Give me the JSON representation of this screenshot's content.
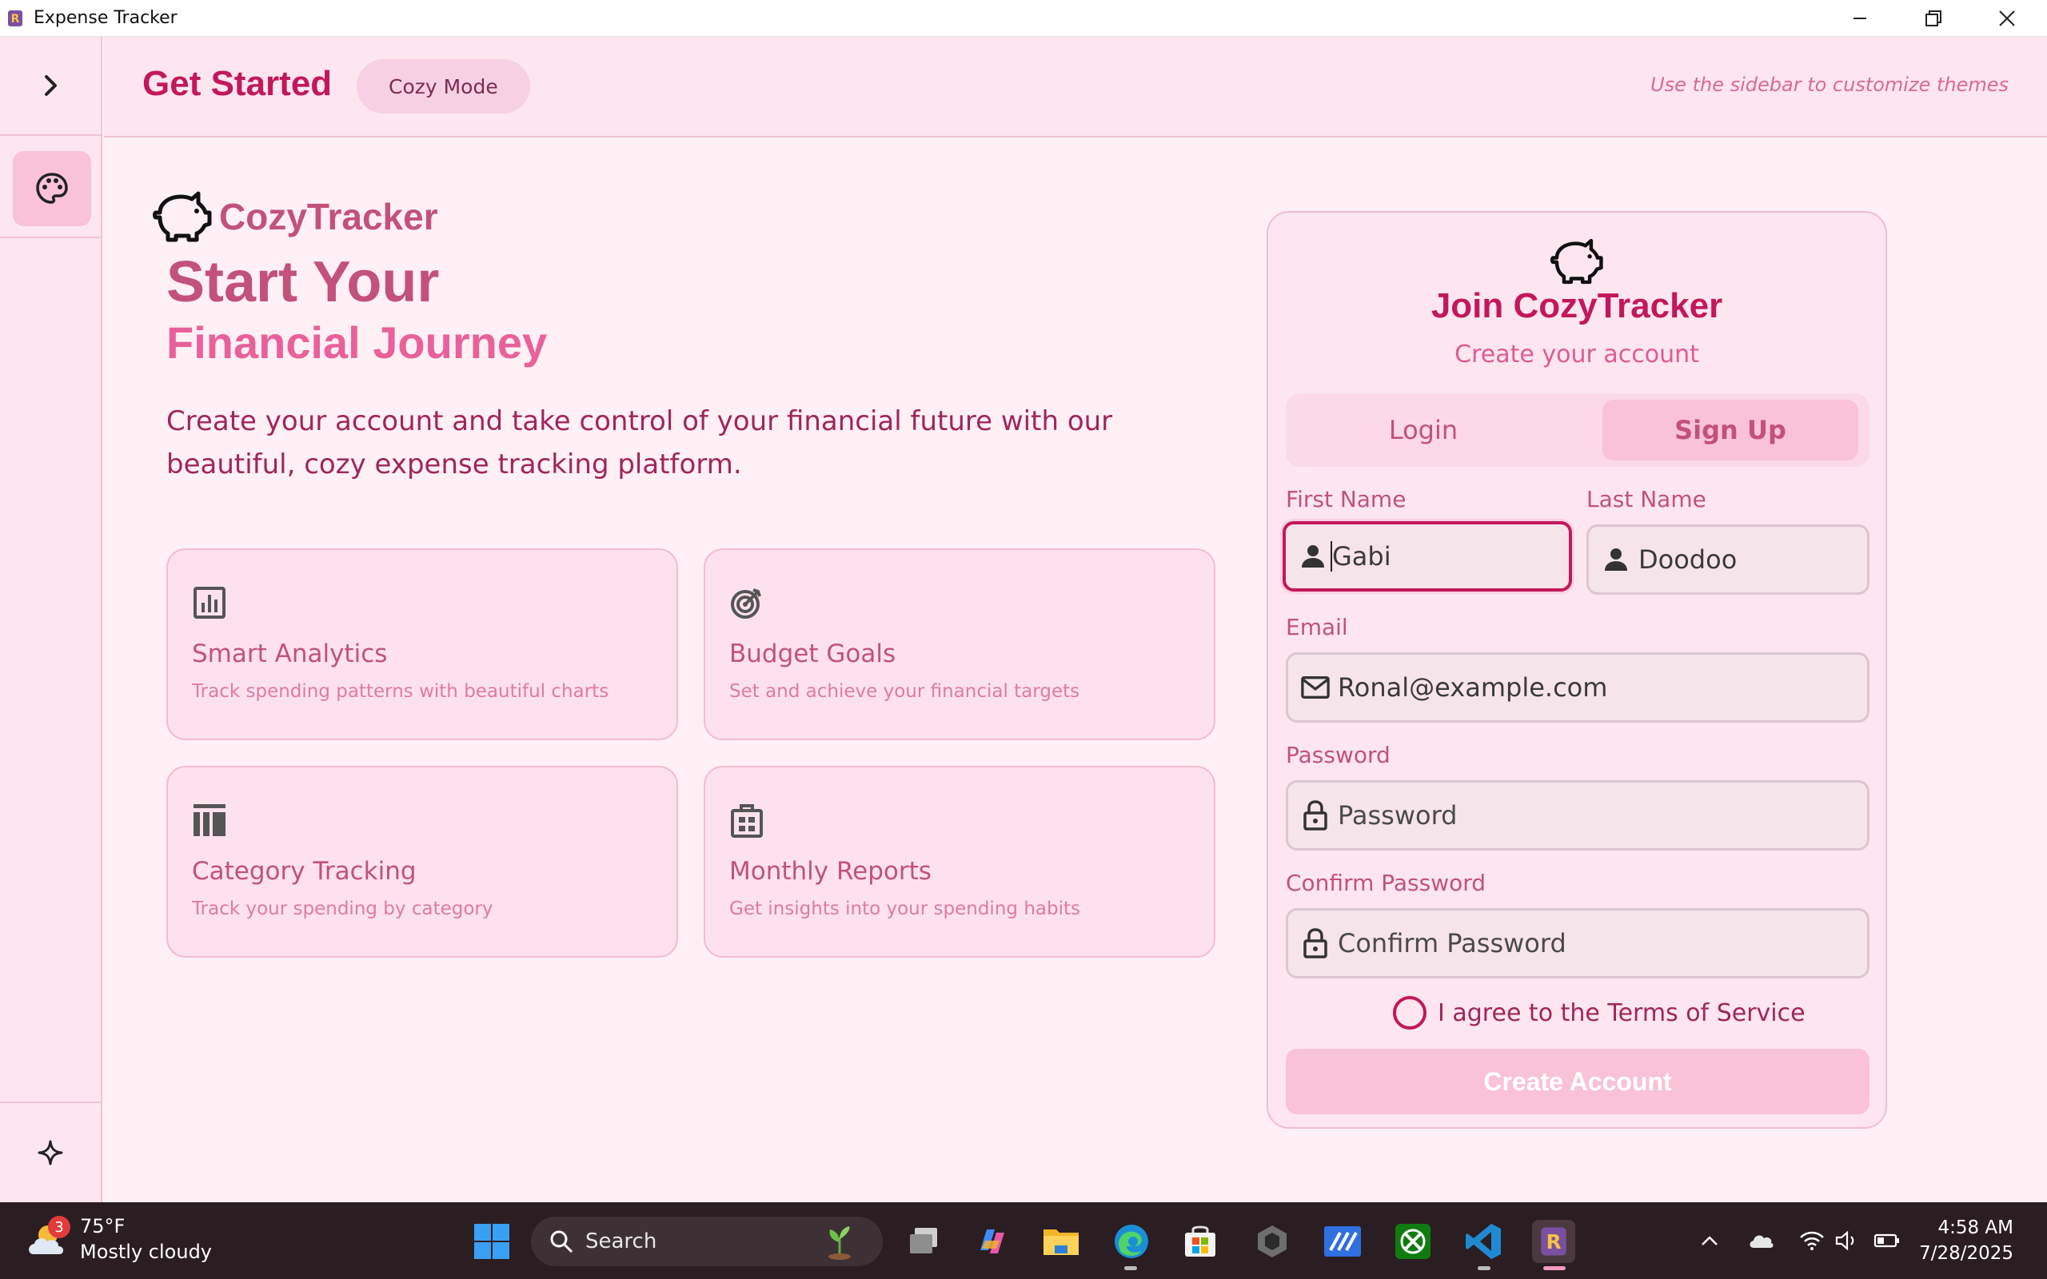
{
  "window": {
    "title": "Expense Tracker"
  },
  "header": {
    "title": "Get Started",
    "mode_label": "Cozy Mode",
    "hint": "Use the sidebar to customize themes"
  },
  "hero": {
    "brand": "CozyTracker",
    "heading_line1": "Start Your",
    "heading_line2": "Financial Journey",
    "description": "Create your account and take control of your financial future with our beautiful, cozy expense tracking platform."
  },
  "features": [
    {
      "icon": "analytics-icon",
      "title": "Smart Analytics",
      "description": "Track spending patterns with beautiful charts"
    },
    {
      "icon": "target-icon",
      "title": "Budget Goals",
      "description": "Set and achieve your financial targets"
    },
    {
      "icon": "category-icon",
      "title": "Category Tracking",
      "description": "Track your spending by category"
    },
    {
      "icon": "reports-icon",
      "title": "Monthly Reports",
      "description": "Get insights into your spending habits"
    }
  ],
  "signup": {
    "title": "Join CozyTracker",
    "subtitle": "Create your account",
    "tabs": {
      "login": "Login",
      "signup": "Sign Up",
      "active": "Sign Up"
    },
    "first_name": {
      "label": "First Name",
      "value": "Gabi"
    },
    "last_name": {
      "label": "Last Name",
      "value": "Doodoo"
    },
    "email": {
      "label": "Email",
      "value": "Ronal@example.com"
    },
    "password": {
      "label": "Password",
      "placeholder": "Password"
    },
    "confirm_password": {
      "label": "Confirm Password",
      "placeholder": "Confirm Password"
    },
    "terms_label": "I agree to the Terms of Service",
    "submit_label": "Create Account"
  },
  "taskbar": {
    "weather": {
      "temp": "75°F",
      "condition": "Mostly cloudy",
      "badge": "3"
    },
    "search_placeholder": "Search",
    "clock": {
      "time": "4:58 AM",
      "date": "7/28/2025"
    }
  },
  "colors": {
    "accent": "#c2185b",
    "accent_light": "#e8619a",
    "panel_bg": "#fde6ef",
    "page_bg": "#fff0f5"
  }
}
